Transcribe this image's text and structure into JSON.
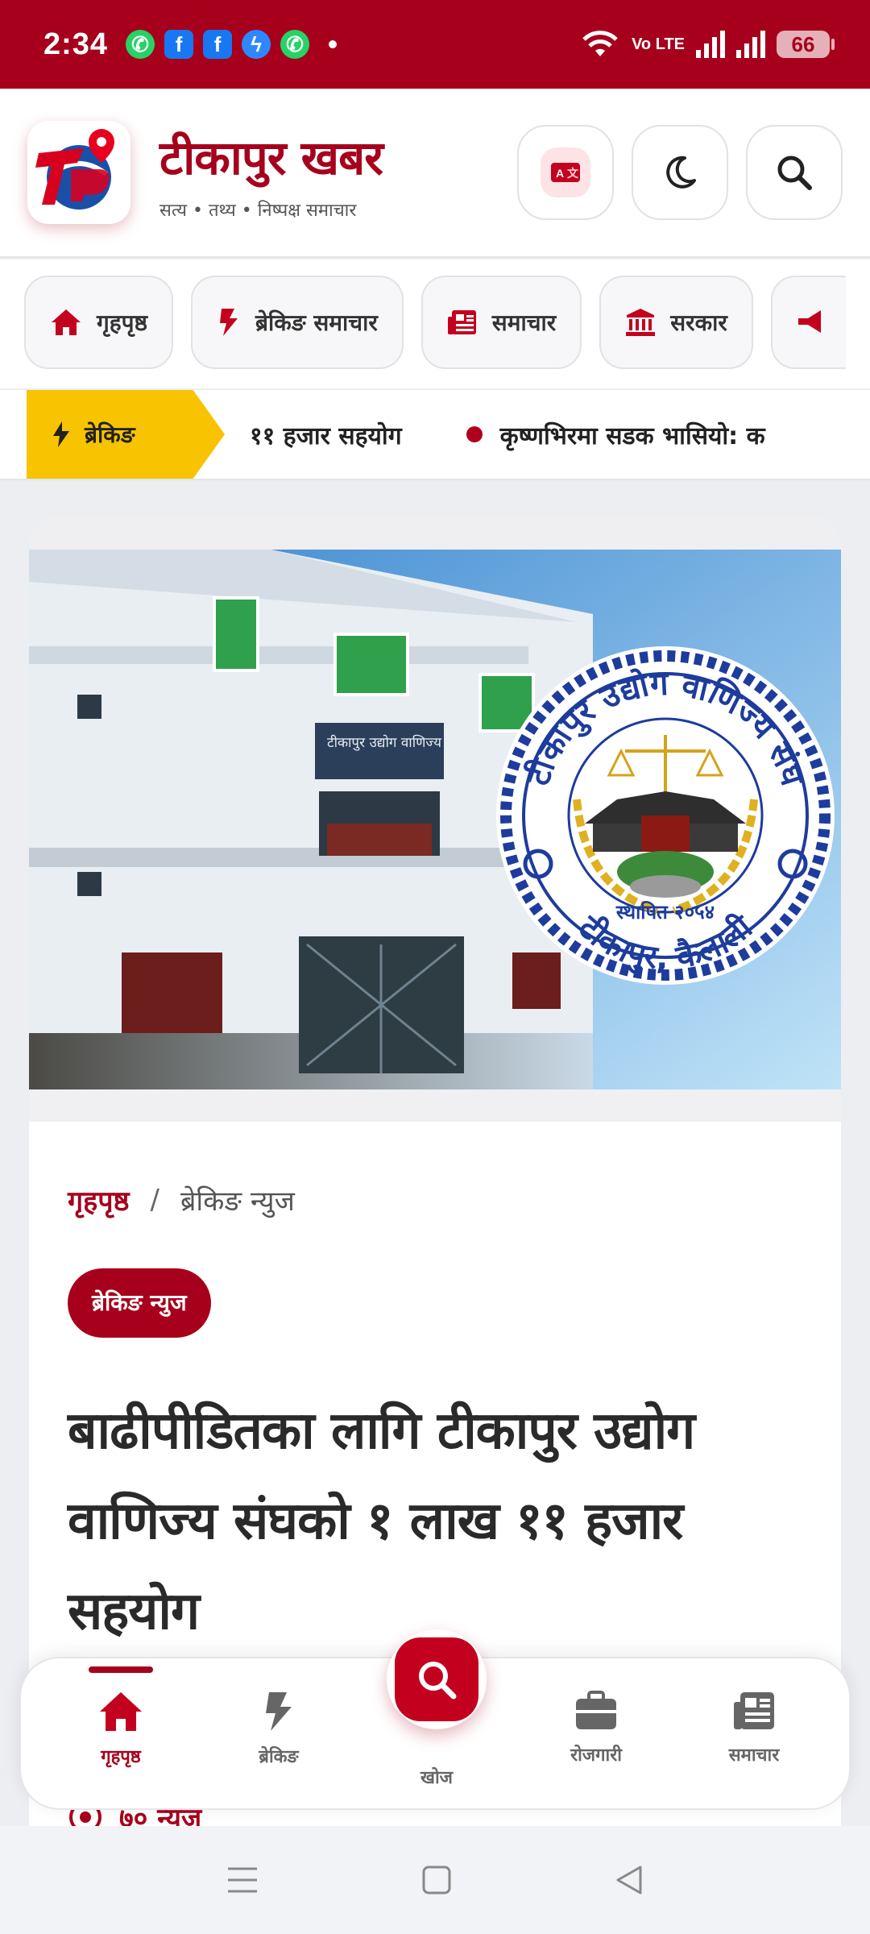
{
  "status_bar": {
    "time": "2:34",
    "notifications": [
      "whatsapp-icon",
      "facebook-icon",
      "facebook-icon",
      "messenger-icon",
      "whatsapp-icon"
    ],
    "volte": "Vo LTE",
    "battery": "66"
  },
  "header": {
    "site_title": "टीकापुर खबर",
    "tagline": "सत्य • तथ्य • निष्पक्ष समाचार",
    "accent_color": "#a6001c"
  },
  "nav": {
    "items": [
      {
        "label": "गृहपृष्ठ",
        "icon": "home-icon"
      },
      {
        "label": "ब्रेकिङ समाचार",
        "icon": "bolt-icon"
      },
      {
        "label": "समाचार",
        "icon": "newspaper-icon"
      },
      {
        "label": "सरकार",
        "icon": "government-icon"
      }
    ]
  },
  "ticker": {
    "label": "ब्रेकिङ",
    "items": [
      "११ हजार सहयोग",
      "कृष्णभिरमा सडक भासियो: क"
    ]
  },
  "article": {
    "hero_image": {
      "sign_text": "टीकापुर उद्योग वाणिज्य संघ",
      "seal_top": "टीकापुर उद्योग वाणिज्य संघ",
      "seal_bottom": "टीकापुर, कैलाली",
      "seal_established": "स्थापित २०५४"
    },
    "breadcrumb_home": "गृहपृष्ठ",
    "breadcrumb_sep": "/",
    "breadcrumb_current": "ब्रेकिङ न्युज",
    "category": "ब्रेकिङ न्युज",
    "title": "बाढीपीडितका लागि टीकापुर उद्योग वाणिज्य संघको १ लाख ११ हजार सहयोग",
    "views_partial": "७० न्युज"
  },
  "bottom_nav": {
    "items": [
      {
        "label": "गृहपृष्ठ",
        "icon": "home-icon",
        "active": true
      },
      {
        "label": "ब्रेकिङ",
        "icon": "bolt-icon",
        "active": false
      },
      {
        "label": "खोज",
        "icon": "search-icon",
        "active": false
      },
      {
        "label": "रोजगारी",
        "icon": "briefcase-icon",
        "active": false
      },
      {
        "label": "समाचार",
        "icon": "newspaper-icon",
        "active": false
      }
    ]
  }
}
